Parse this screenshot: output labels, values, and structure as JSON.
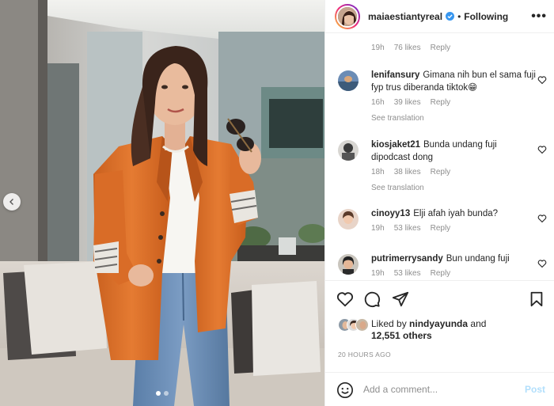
{
  "post_header": {
    "username": "maiaestiantyreal",
    "separator": "•",
    "follow_label": "Following",
    "more_label": "•••",
    "verified_icon": "verified-badge-icon"
  },
  "first_comment_meta": {
    "time": "19h",
    "likes": "76 likes",
    "reply": "Reply"
  },
  "comments": [
    {
      "username": "lenifansury",
      "text": "Gimana nih bun el sama fuji fyp trus diberanda tiktok😁",
      "time": "16h",
      "likes": "39 likes",
      "reply": "Reply",
      "see_translation": "See translation"
    },
    {
      "username": "kiosjaket21",
      "text": "Bunda undang fuji dipodcast dong",
      "time": "18h",
      "likes": "38 likes",
      "reply": "Reply",
      "see_translation": "See translation"
    },
    {
      "username": "cinoyy13",
      "text": "Elji afah iyah bunda?",
      "time": "19h",
      "likes": "53 likes",
      "reply": "Reply"
    },
    {
      "username": "putrimerrysandy",
      "text": "Bun undang fuji",
      "time": "19h",
      "likes": "53 likes",
      "reply": "Reply"
    }
  ],
  "actions": {
    "icons": [
      "heart-icon",
      "comment-icon",
      "share-icon",
      "bookmark-icon"
    ]
  },
  "likes": {
    "prefix": "Liked by",
    "user": "nindyayunda",
    "and": "and",
    "others": "12,551 others"
  },
  "time_ago": "20 HOURS AGO",
  "comment_box": {
    "placeholder": "Add a comment...",
    "post_label": "Post"
  },
  "carousel": {
    "slide_count": 2,
    "active_slide": 1
  },
  "colors": {
    "blazer": "#e0762c",
    "post_disabled": "#b2dffc",
    "verified": "#3897f0"
  }
}
